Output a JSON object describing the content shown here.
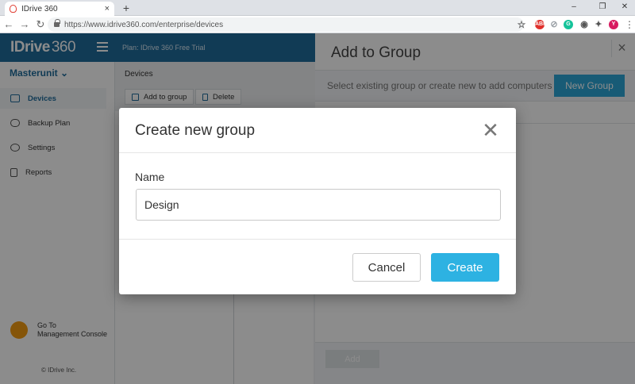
{
  "browser": {
    "tab_title": "IDrive 360",
    "tab_close": "×",
    "new_tab": "+",
    "url": "https://www.idrive360.com/enterprise/devices",
    "window_controls": {
      "minimize": "–",
      "restore": "❐",
      "close": "✕"
    },
    "nav": {
      "back": "←",
      "forward": "→",
      "reload": "↻"
    },
    "extensions": [
      {
        "name": "star-icon",
        "label": "☆",
        "color": "#666666"
      },
      {
        "name": "extension-red-icon",
        "label": "ABP",
        "color": "#e0312c"
      },
      {
        "name": "extension-gray-icon",
        "label": "⊘",
        "color": "#9aa0a6"
      },
      {
        "name": "grammarly-icon",
        "label": "G",
        "color": "#15c39a"
      },
      {
        "name": "extension-ring-icon",
        "label": "◉",
        "color": "#555555"
      },
      {
        "name": "puzzle-icon",
        "label": "✦",
        "color": "#555555"
      },
      {
        "name": "profile-avatar-icon",
        "label": "Y",
        "color": "#d81b60"
      }
    ],
    "menu": "⋮"
  },
  "app": {
    "logo_text": "IDrive",
    "logo_suffix": "360",
    "plan": "Plan: IDrive 360 Free Trial",
    "unit": "Masterunit",
    "sidebar": [
      {
        "label": "Devices",
        "icon": "monitor-icon"
      },
      {
        "label": "Backup Plan",
        "icon": "cloud-icon"
      },
      {
        "label": "Settings",
        "icon": "gear-icon"
      },
      {
        "label": "Reports",
        "icon": "document-icon"
      }
    ],
    "goto_line1": "Go To",
    "goto_line2": "Management Console",
    "copyright": "© IDrive Inc.",
    "content_title": "Devices",
    "add_to_group": "Add to group",
    "delete": "Delete"
  },
  "drawer": {
    "title": "Add to Group",
    "close": "×",
    "hint": "Select existing group or create new to add computers",
    "new_group": "New Group",
    "add": "Add"
  },
  "modal": {
    "title": "Create new group",
    "close": "✕",
    "name_label": "Name",
    "name_value": "Design",
    "cancel": "Cancel",
    "create": "Create"
  },
  "colors": {
    "brand": "#1f6c9c",
    "accent": "#2db2e2"
  }
}
